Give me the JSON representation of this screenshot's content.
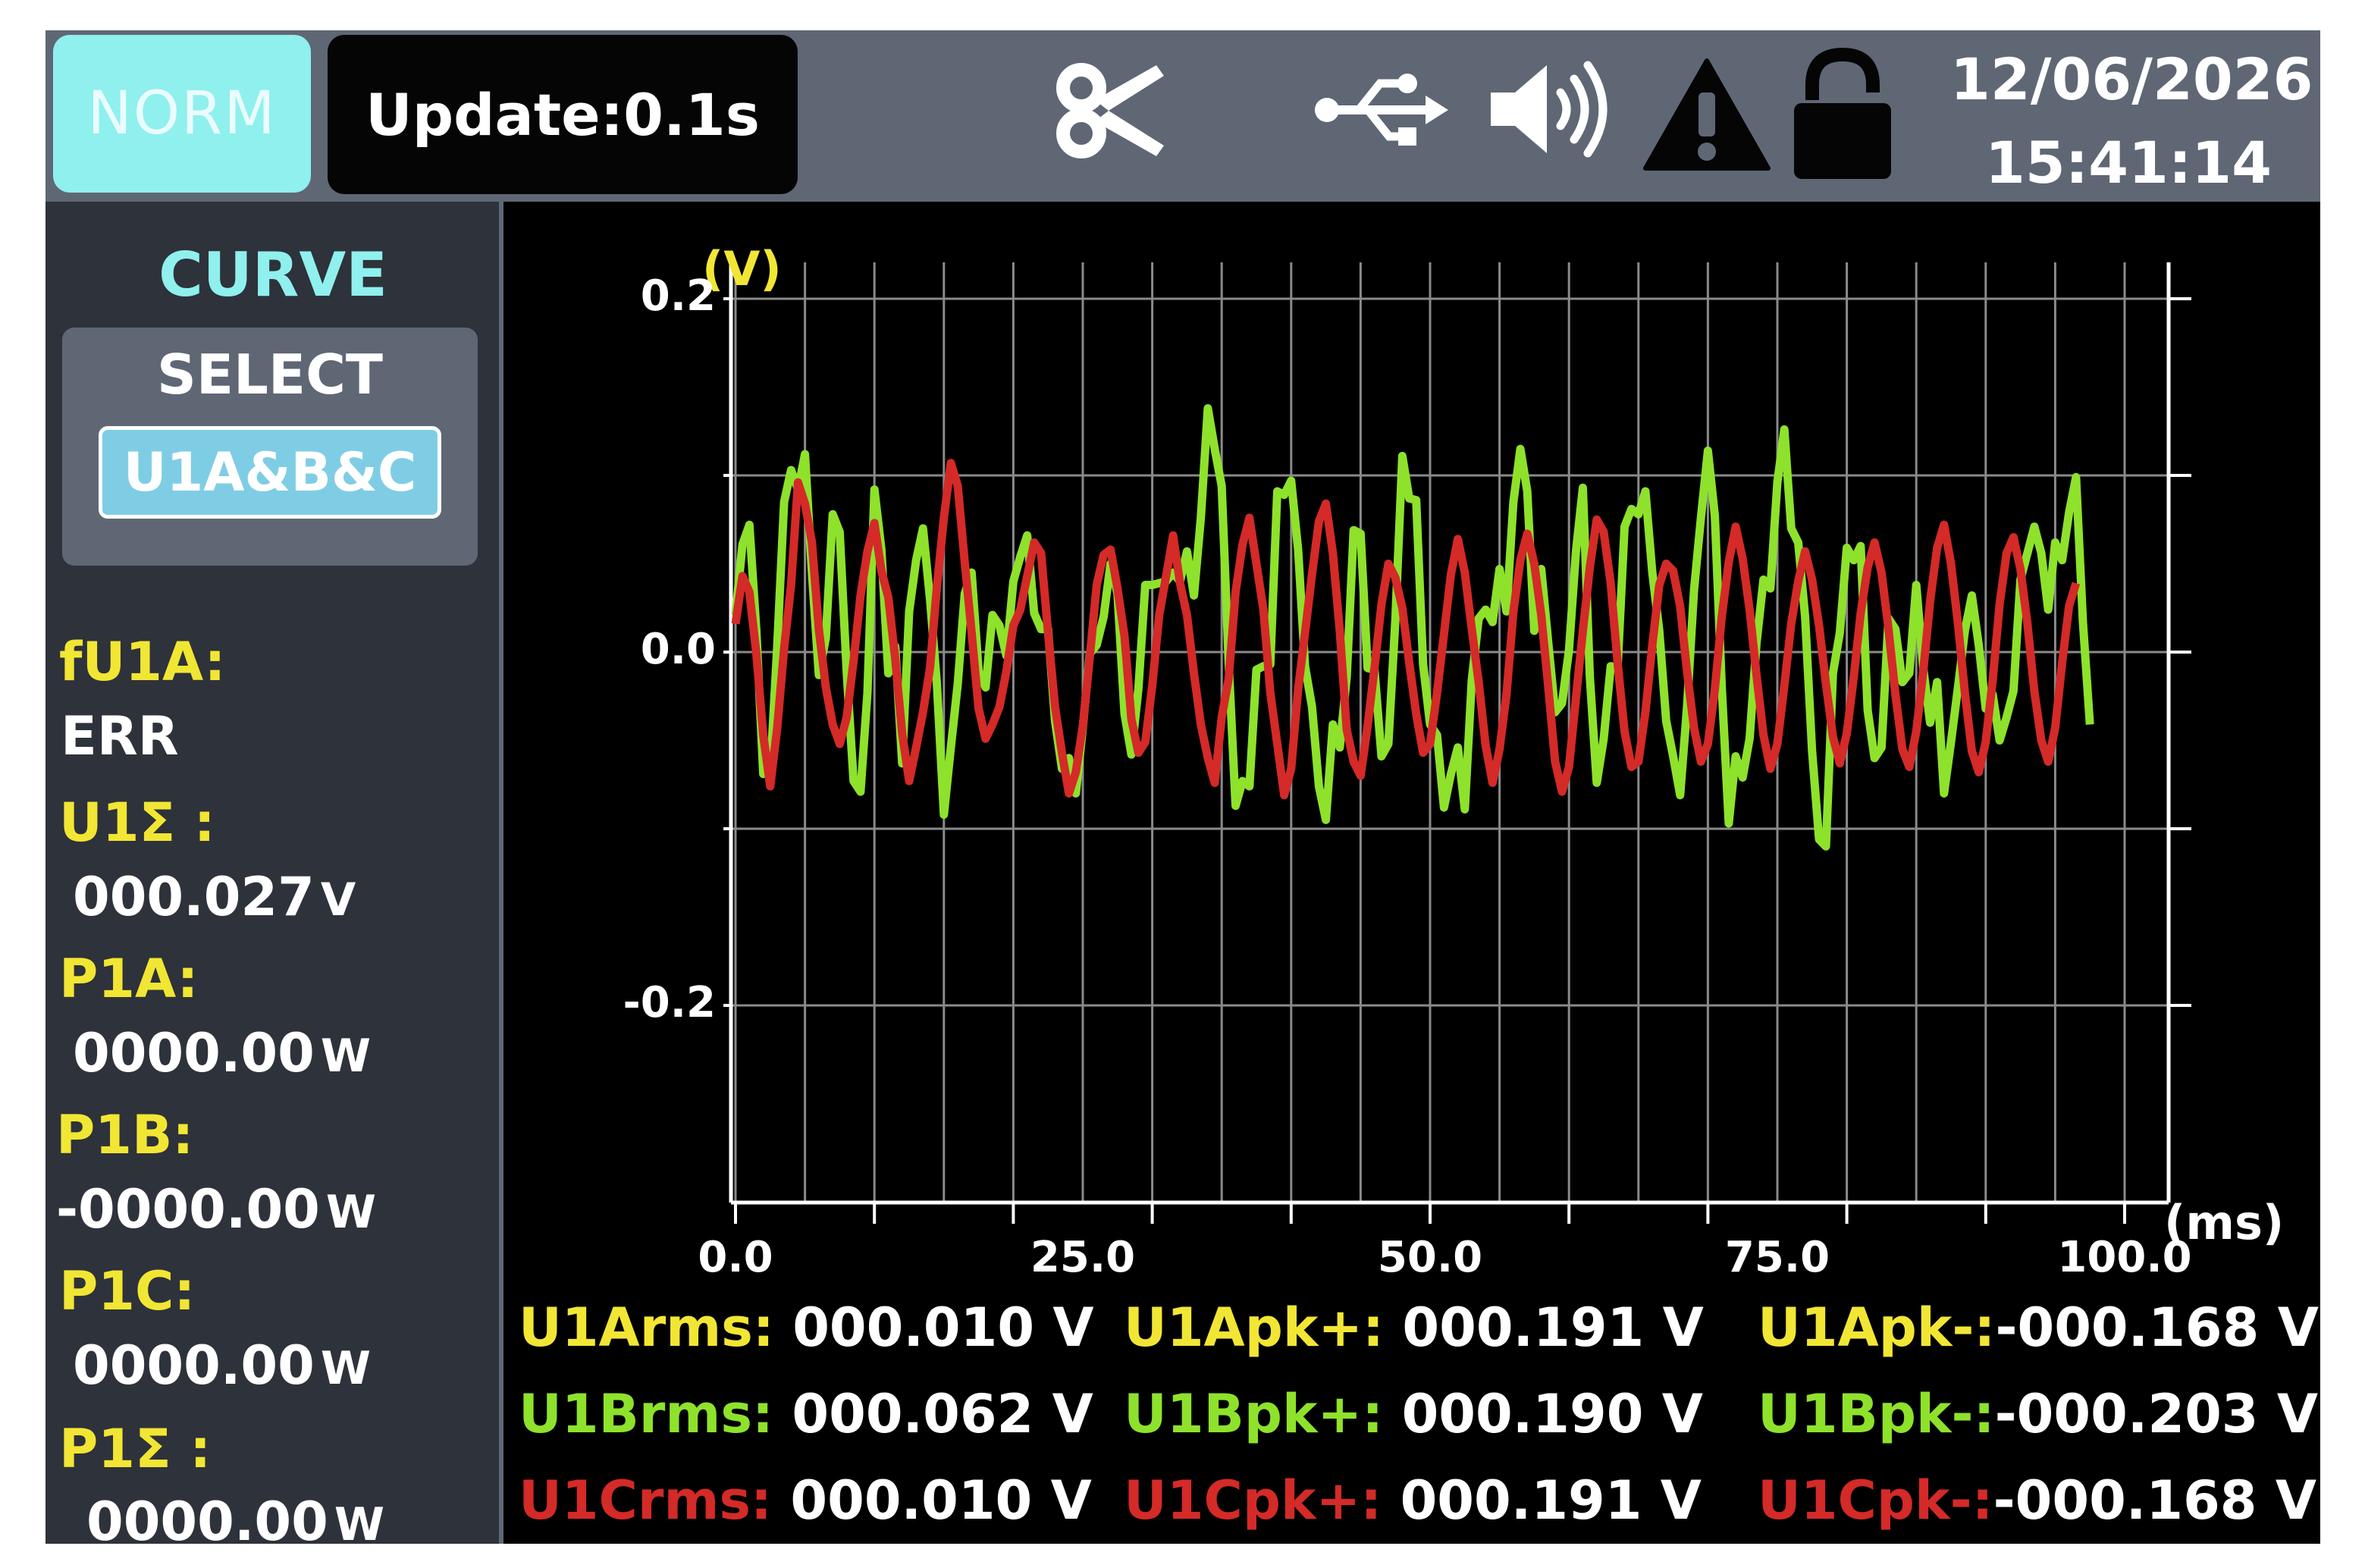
{
  "header": {
    "mode": "NORM",
    "update": "Update:0.1s",
    "date": "12/06/2026",
    "time": "15:41:14",
    "icons": [
      "scissors-icon",
      "usb-icon",
      "speaker-icon",
      "warning-icon",
      "unlock-icon"
    ]
  },
  "sidebar": {
    "title": "CURVE",
    "select_label": "SELECT",
    "select_value": "U1A&B&C",
    "items": [
      {
        "label": "fU1A:",
        "value": "ERR",
        "unit": ""
      },
      {
        "label": "U1Σ :",
        "value": "000.027",
        "unit": "V"
      },
      {
        "label": "P1A:",
        "value": "0000.00",
        "unit": "W"
      },
      {
        "label": "P1B:",
        "value": "-0000.00",
        "unit": "W"
      },
      {
        "label": "P1C:",
        "value": "0000.00",
        "unit": "W"
      },
      {
        "label": "P1Σ :",
        "value": "0000.00",
        "unit": "W"
      }
    ]
  },
  "chart_data": {
    "type": "line",
    "ylabel": "(V)",
    "xlabel": "(ms)",
    "xlim": [
      0,
      100
    ],
    "ylim": [
      -0.2,
      0.2
    ],
    "y_ticks": [
      0.2,
      0.1,
      0.0,
      -0.1,
      -0.2
    ],
    "y_tick_labels": [
      "0.2",
      "",
      "0.0",
      "",
      "-0.2"
    ],
    "x_tick_labels": [
      "0.0",
      "25.0",
      "50.0",
      "75.0",
      "100.0"
    ],
    "x_ticks": [
      0,
      25,
      50,
      75,
      100
    ],
    "grid": true,
    "series": [
      {
        "color": "#8ee22b",
        "sample_interval_ms": 0.5,
        "values": [
          0.021,
          0.061,
          0.072,
          0.012,
          -0.069,
          -0.068,
          0.003,
          0.085,
          0.103,
          0.092,
          0.112,
          0.045,
          -0.013,
          0.008,
          0.078,
          0.068,
          -0.011,
          -0.073,
          -0.079,
          -0.023,
          0.092,
          0.058,
          -0.012,
          0.003,
          -0.063,
          0.023,
          0.052,
          0.07,
          0.03,
          -0.018,
          -0.092,
          -0.054,
          -0.018,
          0.033,
          0.045,
          -0.011,
          -0.02,
          0.021,
          0.015,
          -0.002,
          0.04,
          0.054,
          0.066,
          0.022,
          0.013,
          0.013,
          -0.039,
          -0.066,
          -0.06,
          -0.08,
          -0.043,
          -0.001,
          0.004,
          0.02,
          0.05,
          0.033,
          -0.035,
          -0.058,
          -0.021,
          0.038,
          0.038,
          0.039,
          0.04,
          0.045,
          0.04,
          0.057,
          0.032,
          0.076,
          0.138,
          0.115,
          0.094,
          -0.006,
          -0.087,
          -0.073,
          -0.076,
          -0.01,
          -0.008,
          -0.007,
          0.091,
          0.089,
          0.097,
          0.058,
          -0.008,
          -0.031,
          -0.076,
          -0.095,
          -0.041,
          -0.054,
          -0.014,
          0.069,
          0.067,
          -0.009,
          -0.01,
          -0.059,
          -0.052,
          0.018,
          0.111,
          0.087,
          0.086,
          -0.007,
          -0.041,
          -0.047,
          -0.088,
          -0.069,
          -0.054,
          -0.089,
          -0.016,
          0.019,
          0.024,
          0.017,
          0.047,
          0.023,
          0.085,
          0.115,
          0.091,
          0.012,
          0.047,
          0.006,
          -0.034,
          -0.029,
          0.001,
          0.057,
          0.093,
          -0.014,
          -0.074,
          -0.049,
          -0.008,
          -0.009,
          0.071,
          0.081,
          0.078,
          0.091,
          0.045,
          0.012,
          -0.039,
          -0.059,
          -0.081,
          -0.031,
          0.035,
          0.076,
          0.114,
          0.077,
          -0.02,
          -0.097,
          -0.059,
          -0.071,
          -0.049,
          0.005,
          0.041,
          0.036,
          0.096,
          0.126,
          0.07,
          0.062,
          0.02,
          -0.056,
          -0.106,
          -0.11,
          -0.012,
          0.011,
          0.059,
          0.052,
          0.06,
          -0.033,
          -0.06,
          -0.054,
          0.019,
          0.013,
          -0.017,
          -0.012,
          0.038,
          -0.009,
          -0.04,
          -0.017,
          -0.08,
          -0.051,
          -0.02,
          0.012,
          0.032,
          0.004,
          -0.032,
          -0.024,
          -0.05,
          -0.037,
          -0.022,
          0.041,
          0.056,
          0.071,
          0.056,
          0.024,
          0.062,
          0.052,
          0.079,
          0.099,
          0.017,
          -0.041
        ]
      },
      {
        "color": "#d42a28",
        "sample_interval_ms": 0.5,
        "values": [
          0.016,
          0.043,
          0.034,
          -0.001,
          -0.047,
          -0.076,
          -0.043,
          0.002,
          0.038,
          0.096,
          0.084,
          0.062,
          0.013,
          -0.02,
          -0.041,
          -0.052,
          -0.037,
          -0.005,
          0.032,
          0.057,
          0.073,
          0.046,
          0.031,
          -0.004,
          -0.046,
          -0.073,
          -0.054,
          -0.034,
          -0.009,
          0.037,
          0.076,
          0.107,
          0.094,
          0.051,
          0.011,
          -0.032,
          -0.049,
          -0.041,
          -0.031,
          -0.011,
          0.015,
          0.024,
          0.043,
          0.062,
          0.056,
          0.011,
          -0.031,
          -0.057,
          -0.08,
          -0.068,
          -0.042,
          -0.003,
          0.038,
          0.055,
          0.058,
          0.036,
          0.009,
          -0.038,
          -0.057,
          -0.051,
          -0.019,
          0.021,
          0.043,
          0.066,
          0.039,
          0.021,
          -0.012,
          -0.041,
          -0.06,
          -0.074,
          -0.037,
          -0.015,
          0.034,
          0.061,
          0.076,
          0.05,
          0.024,
          -0.023,
          -0.052,
          -0.081,
          -0.066,
          -0.021,
          0.011,
          0.044,
          0.074,
          0.084,
          0.056,
          0.012,
          -0.044,
          -0.062,
          -0.07,
          -0.042,
          -0.009,
          0.027,
          0.05,
          0.042,
          0.025,
          -0.006,
          -0.035,
          -0.057,
          -0.052,
          -0.023,
          0.01,
          0.044,
          0.064,
          0.045,
          0.013,
          -0.017,
          -0.053,
          -0.074,
          -0.055,
          -0.024,
          0.023,
          0.052,
          0.067,
          0.05,
          0.021,
          -0.019,
          -0.062,
          -0.079,
          -0.065,
          -0.026,
          0.012,
          0.048,
          0.075,
          0.068,
          0.039,
          -0.006,
          -0.045,
          -0.065,
          -0.062,
          -0.034,
          0.004,
          0.038,
          0.05,
          0.046,
          0.026,
          -0.011,
          -0.043,
          -0.062,
          -0.052,
          -0.021,
          0.02,
          0.051,
          0.071,
          0.053,
          0.024,
          -0.013,
          -0.047,
          -0.066,
          -0.052,
          -0.019,
          0.016,
          0.04,
          0.057,
          0.041,
          0.015,
          -0.018,
          -0.048,
          -0.063,
          -0.046,
          -0.014,
          0.022,
          0.048,
          0.062,
          0.045,
          0.013,
          -0.024,
          -0.055,
          -0.065,
          -0.045,
          -0.011,
          0.029,
          0.059,
          0.072,
          0.05,
          0.016,
          -0.023,
          -0.056,
          -0.068,
          -0.051,
          -0.016,
          0.027,
          0.056,
          0.065,
          0.047,
          0.016,
          -0.022,
          -0.05,
          -0.062,
          -0.043,
          -0.006,
          0.026,
          0.039
        ]
      }
    ]
  },
  "readouts": [
    {
      "label": "U1Arms:",
      "value": "000.010 V",
      "color": "#f2e634"
    },
    {
      "label": "U1Apk+:",
      "value": "000.191 V",
      "color": "#f2e634"
    },
    {
      "label": "U1Apk-:",
      "value": "-000.168 V",
      "color": "#f2e634"
    },
    {
      "label": "U1Brms:",
      "value": "000.062 V",
      "color": "#8ee22b"
    },
    {
      "label": "U1Bpk+:",
      "value": "000.190 V",
      "color": "#8ee22b"
    },
    {
      "label": "U1Bpk-:",
      "value": "-000.203 V",
      "color": "#8ee22b"
    },
    {
      "label": "U1Crms:",
      "value": "000.010 V",
      "color": "#d42a28"
    },
    {
      "label": "U1Cpk+:",
      "value": "000.191 V",
      "color": "#d42a28"
    },
    {
      "label": "U1Cpk-:",
      "value": "-000.168 V",
      "color": "#d42a28"
    }
  ]
}
